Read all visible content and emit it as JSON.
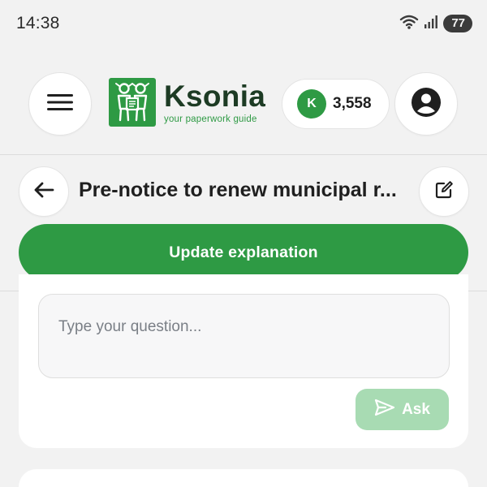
{
  "status_bar": {
    "time": "14:38",
    "battery": "77",
    "icons": [
      "wifi-icon",
      "signal-icon",
      "battery-icon"
    ]
  },
  "header": {
    "brand_name": "Ksonia",
    "brand_tagline": "your paperwork guide",
    "points_badge": "K",
    "points_value": "3,558",
    "icons": [
      "menu-icon",
      "profile-icon"
    ]
  },
  "document": {
    "title": "Pre-notice to renew municipal r...",
    "update_label": "Update explanation"
  },
  "question": {
    "placeholder": "Type your question...",
    "ask_label": "Ask"
  },
  "next_section": {
    "heading": ""
  },
  "colors": {
    "accent": "#2e9a44",
    "accent_disabled": "#a8dbb3",
    "brand_text": "#1d3b24",
    "background": "#f2f2f2"
  }
}
